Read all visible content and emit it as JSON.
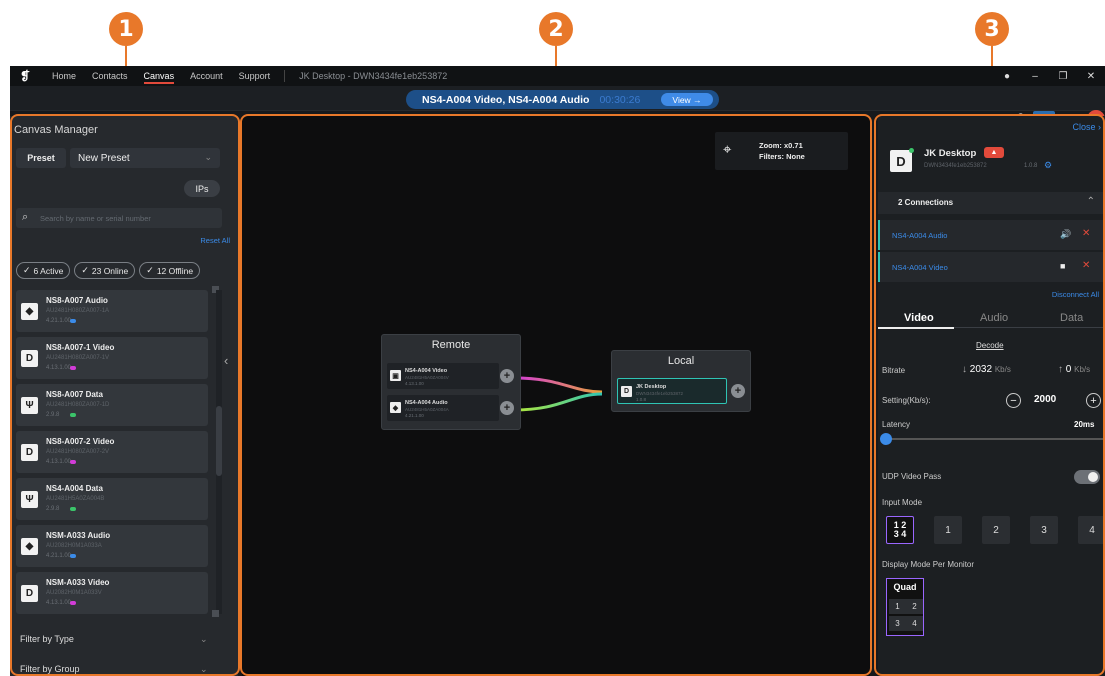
{
  "callouts": [
    "1",
    "2",
    "3"
  ],
  "topbar": {
    "nav": [
      "Home",
      "Contacts",
      "Canvas",
      "Account",
      "Support"
    ],
    "device_title": "JK Desktop - DWN3434fe1eb253872"
  },
  "session": {
    "title": "NS4-A004 Video, NS4-A004 Audio",
    "timer": "00:30:26",
    "view_label": "View"
  },
  "left": {
    "title": "Canvas Manager",
    "preset_label": "Preset",
    "preset_value": "New Preset",
    "ips_label": "IPs",
    "search_placeholder": "Search by name or serial number",
    "reset_all": "Reset All",
    "filters": [
      {
        "label": "6 Active"
      },
      {
        "label": "23 Online"
      },
      {
        "label": "12 Offline"
      }
    ],
    "devices": [
      {
        "name": "NS8-A007 Audio",
        "serial": "AU2481H080ZA007-1A",
        "version": "4.21.1.00",
        "icon": "icon-audio",
        "tag_color": "#3b8be8"
      },
      {
        "name": "NS8-A007-1 Video",
        "serial": "AU2481H080ZA007-1V",
        "version": "4.13.1.00",
        "icon": "icon-display",
        "tag_color": "#d23cd8"
      },
      {
        "name": "NS8-A007 Data",
        "serial": "AU2481H080ZA007-1D",
        "version": "2.9.8",
        "icon": "icon-usb",
        "tag_color": "#3bc46a"
      },
      {
        "name": "NS8-A007-2 Video",
        "serial": "AU2481H080ZA007-2V",
        "version": "4.13.1.00",
        "icon": "icon-display",
        "tag_color": "#d23cd8"
      },
      {
        "name": "NS4-A004 Data",
        "serial": "AU2481H5A0ZA004B",
        "version": "2.9.8",
        "icon": "icon-usb",
        "tag_color": "#3bc46a"
      },
      {
        "name": "NSM-A033 Audio",
        "serial": "AU2082H0M1A033A",
        "version": "4.21.1.00",
        "icon": "icon-audio",
        "tag_color": "#3b8be8"
      },
      {
        "name": "NSM-A033 Video",
        "serial": "AU2082H0M1A033V",
        "version": "4.13.1.00",
        "icon": "icon-display",
        "tag_color": "#d23cd8"
      }
    ],
    "filter_by_type": "Filter by Type",
    "filter_by_group": "Filter by Group"
  },
  "canvas": {
    "zoom_text": "Zoom: x0.71",
    "filters_text": "Filters: None",
    "remote": {
      "title": "Remote",
      "rows": [
        {
          "name": "NS4-A004 Video",
          "serial": "AU2481H5A0ZA004V",
          "version": "4.13.1.00"
        },
        {
          "name": "NS4-A004 Audio",
          "serial": "AU2481H5A0ZA004A",
          "version": "4.21.1.00"
        }
      ]
    },
    "local": {
      "title": "Local",
      "row": {
        "name": "JK Desktop",
        "serial": "DWN3434fe1eb253872",
        "version": "1.0.8"
      }
    },
    "link_colors": [
      "#d23cd8",
      "#e8a23a",
      "#2fc4b4",
      "#b4e83a"
    ]
  },
  "right": {
    "close_label": "Close",
    "device_name": "JK Desktop",
    "device_serial": "DWN3434fe1eb253872",
    "device_version": "1.0.8",
    "connections_label": "2 Connections",
    "connections": [
      {
        "name": "NS4-A004 Audio",
        "icon": "speaker-icon"
      },
      {
        "name": "NS4-A004 Video",
        "icon": "camera-icon"
      }
    ],
    "disconnect_all": "Disconnect All",
    "tabs": [
      "Video",
      "Audio",
      "Data"
    ],
    "decode_label": "Decode",
    "bitrate_label": "Bitrate",
    "bitrate_down": "2032",
    "bitrate_up": "0",
    "bitrate_unit": "Kb/s",
    "setting_label": "Setting(Kb/s):",
    "setting_value": "2000",
    "latency_label": "Latency",
    "latency_value": "20ms",
    "latency_fraction": 0.0,
    "udp_label": "UDP Video Pass",
    "input_mode_label": "Input Mode",
    "input_modes": [
      "1",
      "2",
      "3",
      "4"
    ],
    "display_mode_label": "Display Mode Per Monitor",
    "display_mode_value": "Quad",
    "accent_color": "#e8782a"
  }
}
